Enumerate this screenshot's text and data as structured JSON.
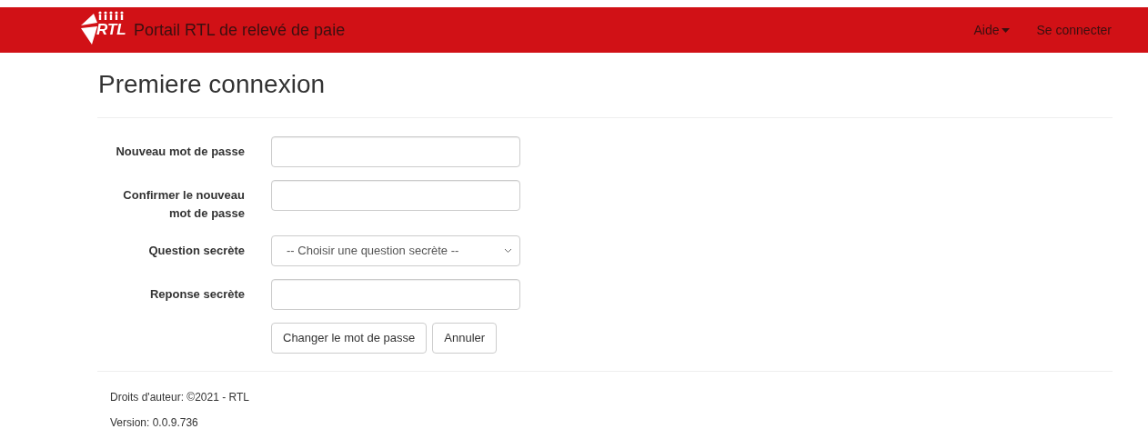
{
  "navbar": {
    "logo": {
      "text": "RTL"
    },
    "brand": "Portail RTL de relevé de paie",
    "links": [
      {
        "label": "Aide",
        "kind": "dropdown"
      },
      {
        "label": "Se connecter",
        "kind": "link"
      }
    ]
  },
  "page_title": "Premiere connexion",
  "form": {
    "fields": [
      {
        "label": "Nouveau mot de passe",
        "kind": "input"
      },
      {
        "label": "Confirmer le nouveau mot de passe",
        "kind": "input"
      },
      {
        "label": "Question secrète",
        "kind": "select",
        "placeholder": "-- Choisir une question secrète --"
      },
      {
        "label": "Reponse secrète",
        "kind": "input"
      }
    ],
    "buttons": [
      "Changer le mot de passe",
      "Annuler"
    ]
  },
  "footer": {
    "copyright": "Droits d'auteur: ©2021 - RTL",
    "version": "Version: 0.0.9.736"
  }
}
